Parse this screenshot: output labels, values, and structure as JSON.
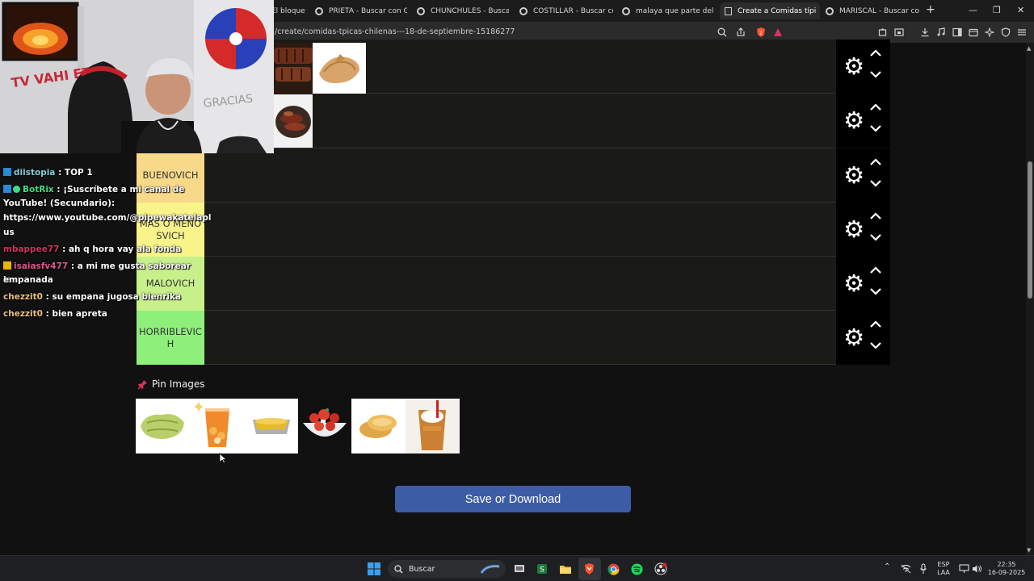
{
  "browser": {
    "tabs": [
      {
        "label": "El bloque"
      },
      {
        "label": "PRIETA - Buscar con Goog"
      },
      {
        "label": "CHUNCHULES - Buscar co"
      },
      {
        "label": "COSTILLAR - Buscar con G"
      },
      {
        "label": "malaya que parte del cerd"
      },
      {
        "label": "Create a Comidas típi",
        "active": true
      },
      {
        "label": "MARISCAL - Buscar con G"
      }
    ],
    "new_tab_label": "+",
    "url": "/create/comidas-tpicas-chilenas---18-de-septiembre-15186277"
  },
  "chat": {
    "messages": [
      {
        "user": "diistopia",
        "text": ": TOP 1",
        "color": "#7fd0e0"
      },
      {
        "user": "BotRix",
        "text": ": ¡Suscríbete a mi canal de",
        "color": "#3ddc84"
      },
      {
        "user": "",
        "text": "YouTube! (Secundario):",
        "color": "#ffffff"
      },
      {
        "user": "",
        "text": "https://www.youtube.com/@pipewakatelapl",
        "color": "#ffffff"
      },
      {
        "user": "",
        "text": "us",
        "color": "#ffffff"
      },
      {
        "user": "mbappee77",
        "text": ": ah q hora vay ala fonda",
        "color": "#d0345a"
      },
      {
        "user": "isaiasfv477",
        "text": ": a mi me gusta saborear la",
        "color": "#e0558c"
      },
      {
        "user": "",
        "text": "empanada",
        "color": "#ffffff"
      },
      {
        "user": "chezzit0",
        "text": ": su empana jugosa bienrika",
        "color": "#e8c07a"
      },
      {
        "user": "chezzit0",
        "text": ": bien apreta",
        "color": "#e8c07a"
      }
    ]
  },
  "tiers": [
    {
      "label": "",
      "color": "#1a1a17"
    },
    {
      "label": "",
      "color": "#1a1a17"
    },
    {
      "label": "BUENOVICH",
      "color": "#f8d98a"
    },
    {
      "label": "MÁS O MENOSVICH",
      "color": "#f8f48a"
    },
    {
      "label": "MALOVICH",
      "color": "#c8f08a"
    },
    {
      "label": "HORRIBLEVICH",
      "color": "#8ef07a"
    }
  ],
  "pin": {
    "title": "Pin Images"
  },
  "save_button": "Save or Download",
  "taskbar": {
    "search_label": "Buscar",
    "lang_top": "ESP",
    "lang_bottom": "LAA",
    "time": "22:35",
    "date": "16-09-2025"
  },
  "icons": [
    "fire-icon",
    "gear-icon",
    "chevron-up-icon",
    "chevron-down-icon",
    "pin-icon",
    "windows-start-icon",
    "search-icon"
  ],
  "colors": {
    "save_button": "#3c5ca6",
    "control_column": "#000000"
  }
}
